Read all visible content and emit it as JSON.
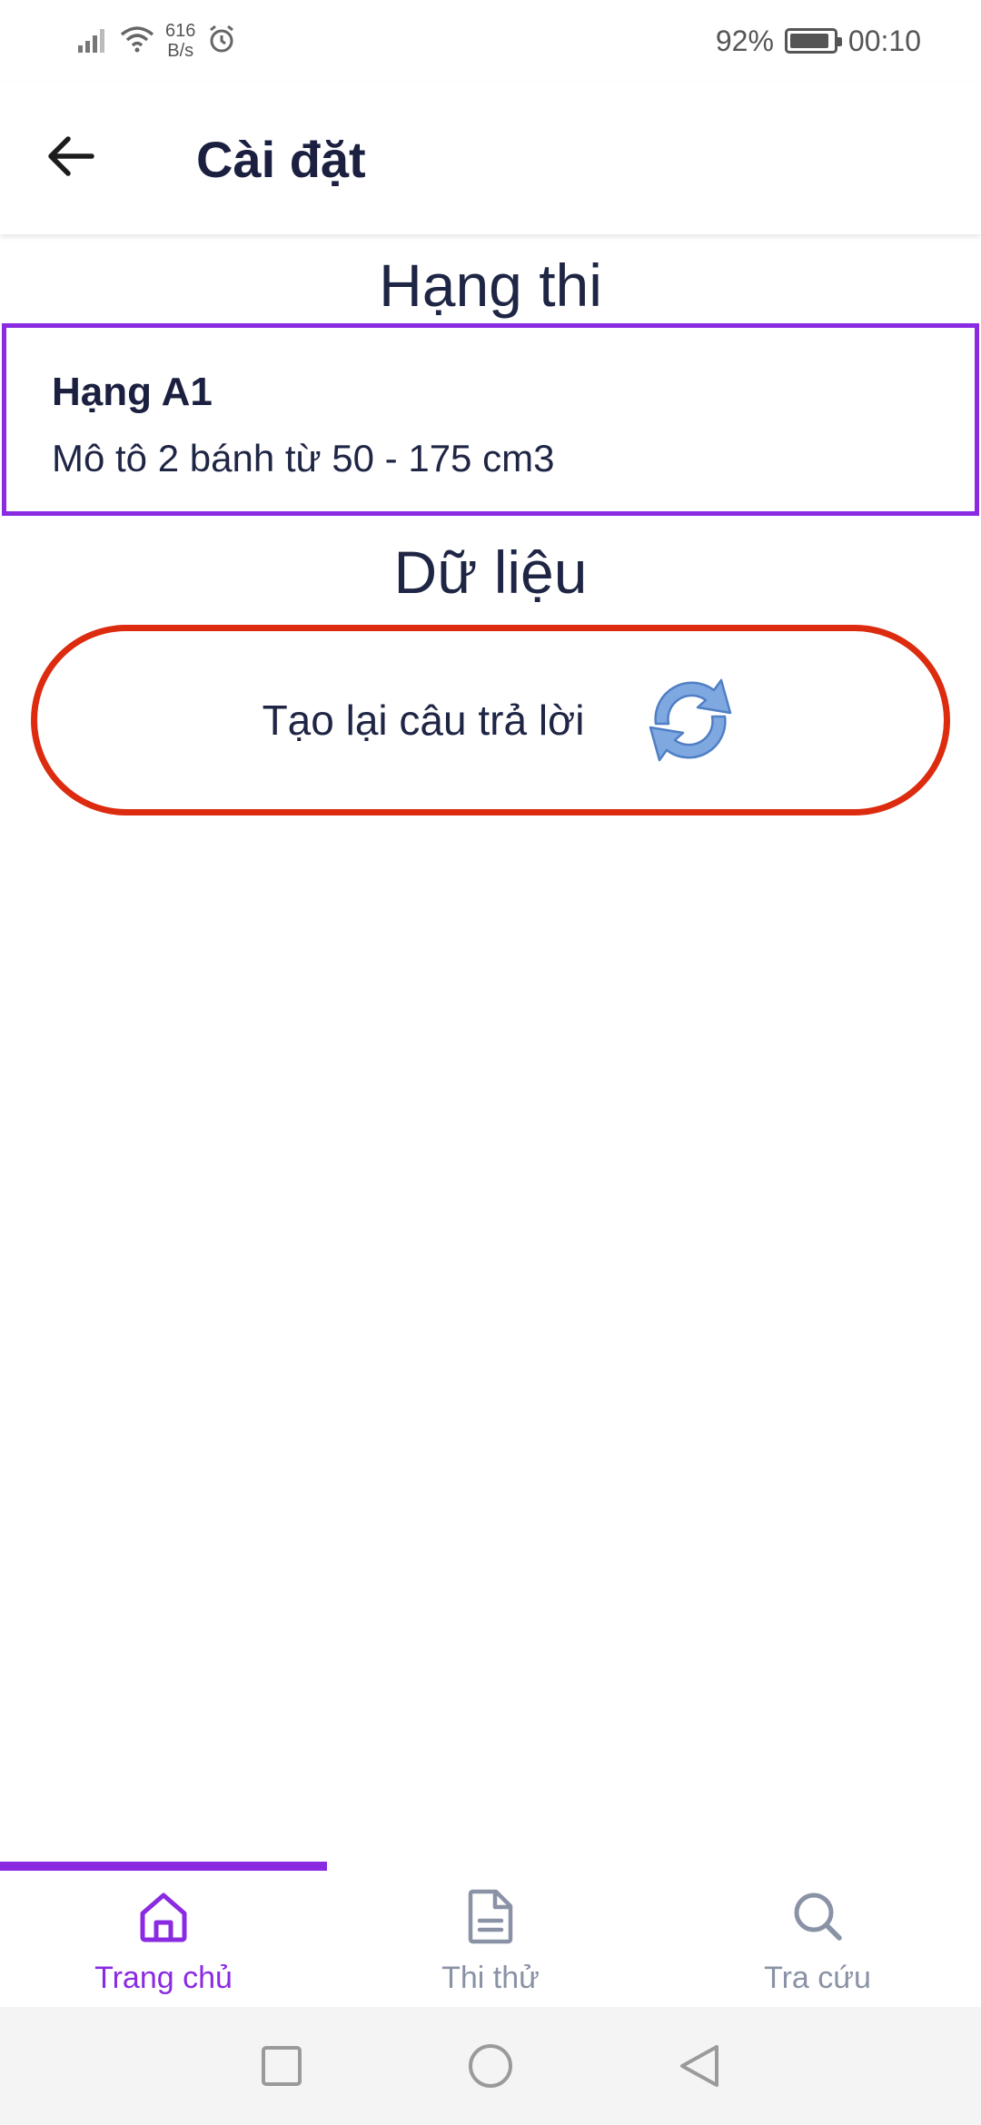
{
  "status_bar": {
    "net_speed_value": "616",
    "net_speed_unit": "B/s",
    "battery": "92%",
    "battery_level": 0.92,
    "time": "00:10",
    "icons": [
      "signal-icon",
      "wifi-icon",
      "alarm-icon",
      "battery-icon"
    ]
  },
  "app_bar": {
    "title": "Cài đặt",
    "back_icon": "arrow-left-icon"
  },
  "sections": {
    "rank_heading": "Hạng thi",
    "data_heading": "Dữ liệu"
  },
  "rank_card": {
    "title": "Hạng A1",
    "description": "Mô tô 2 bánh từ 50 - 175 cm3",
    "border_color": "#8a2be2"
  },
  "regenerate_button": {
    "label": "Tạo lại câu trả lời",
    "icon": "refresh-icon",
    "border_color": "#dc2b0f",
    "icon_color": "#7fa8e0"
  },
  "bottom_nav": {
    "items": [
      {
        "label": "Trang chủ",
        "icon": "home-icon",
        "active": true
      },
      {
        "label": "Thi thử",
        "icon": "document-icon",
        "active": false
      },
      {
        "label": "Tra cứu",
        "icon": "search-icon",
        "active": false
      }
    ],
    "active_color": "#8a2be2",
    "inactive_color": "#8a92a6"
  },
  "system_nav": {
    "icons": [
      "recent-apps-icon",
      "home-circle-icon",
      "back-triangle-icon"
    ]
  }
}
